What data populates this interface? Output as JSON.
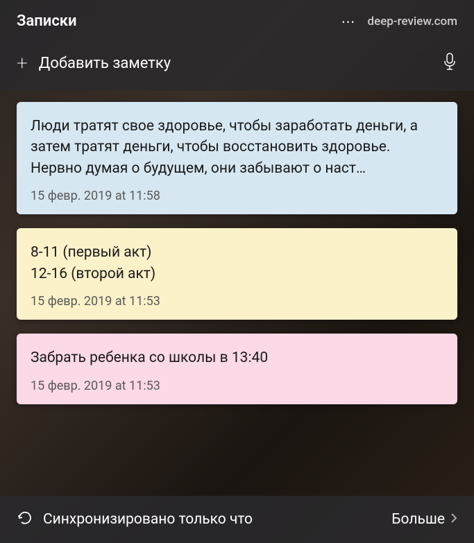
{
  "header": {
    "title": "Записки",
    "watermark": "deep-review.com"
  },
  "addNote": {
    "placeholder": "Добавить заметку"
  },
  "notes": [
    {
      "content": "Люди тратят свое здоровье, чтобы заработать деньги, а затем тратят деньги, чтобы восстановить здоровье.\nНервно думая о будущем, они забывают о наст…",
      "timestamp": "15 февр. 2019 at 11:58",
      "color": "blue"
    },
    {
      "content": "8-11 (первый акт)\n12-16 (второй акт)",
      "timestamp": "15 февр. 2019 at 11:53",
      "color": "yellow"
    },
    {
      "content": "Забрать ребенка со школы в 13:40",
      "timestamp": "15 февр. 2019 at 11:53",
      "color": "pink"
    }
  ],
  "syncBar": {
    "status": "Синхронизировано только что",
    "moreLabel": "Больше"
  }
}
